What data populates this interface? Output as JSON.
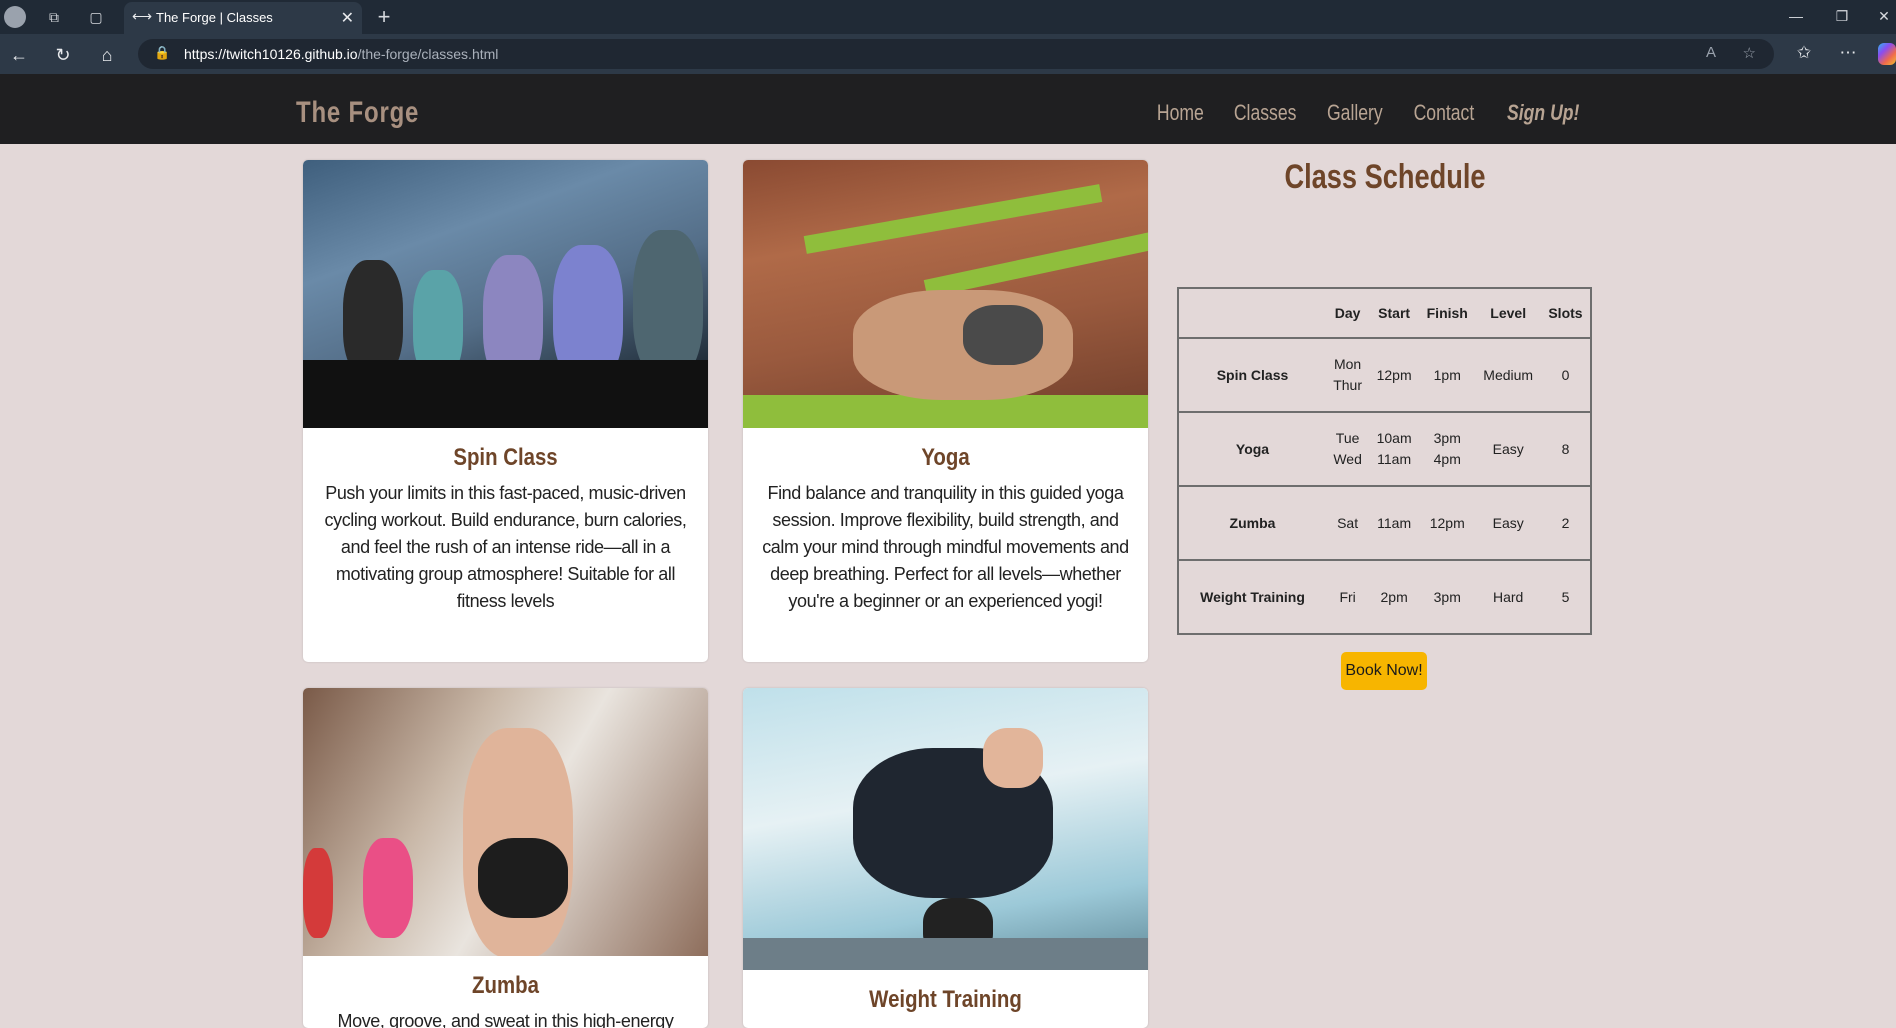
{
  "browser": {
    "tab_title": "The Forge | Classes",
    "url_domain": "https://twitch10126.github.io",
    "url_path": "/the-forge/classes.html"
  },
  "site": {
    "brand": "The Forge",
    "nav": [
      "Home",
      "Classes",
      "Gallery",
      "Contact",
      "Sign Up!"
    ]
  },
  "cards": [
    {
      "title": "Spin Class",
      "text": "Push your limits in this fast-paced, music-driven cycling workout. Build endurance, burn calories, and feel the rush of an intense ride—all in a motivating group atmosphere! Suitable for all fitness levels"
    },
    {
      "title": "Yoga",
      "text": "Find balance and tranquility in this guided yoga session. Improve flexibility, build strength, and calm your mind through mindful movements and deep breathing. Perfect for all levels—whether you're a beginner or an experienced yogi!"
    },
    {
      "title": "Zumba",
      "text": "Move, groove, and sweat in this high-energy dance"
    },
    {
      "title": "Weight Training",
      "text": ""
    }
  ],
  "schedule": {
    "title": "Class Schedule",
    "headers": [
      "",
      "Day",
      "Start",
      "Finish",
      "Level",
      "Slots"
    ],
    "rows": [
      {
        "class": "Spin Class",
        "day": [
          "Mon",
          "Thur"
        ],
        "start": [
          "12pm"
        ],
        "finish": [
          "1pm"
        ],
        "level": "Medium",
        "slots": "0"
      },
      {
        "class": "Yoga",
        "day": [
          "Tue",
          "Wed"
        ],
        "start": [
          "10am",
          "11am"
        ],
        "finish": [
          "3pm",
          "4pm"
        ],
        "level": "Easy",
        "slots": "8"
      },
      {
        "class": "Zumba",
        "day": [
          "Sat"
        ],
        "start": [
          "11am"
        ],
        "finish": [
          "12pm"
        ],
        "level": "Easy",
        "slots": "2"
      },
      {
        "class": "Weight Training",
        "day": [
          "Fri"
        ],
        "start": [
          "2pm"
        ],
        "finish": [
          "3pm"
        ],
        "level": "Hard",
        "slots": "5"
      }
    ],
    "book_label": "Book Now!"
  }
}
